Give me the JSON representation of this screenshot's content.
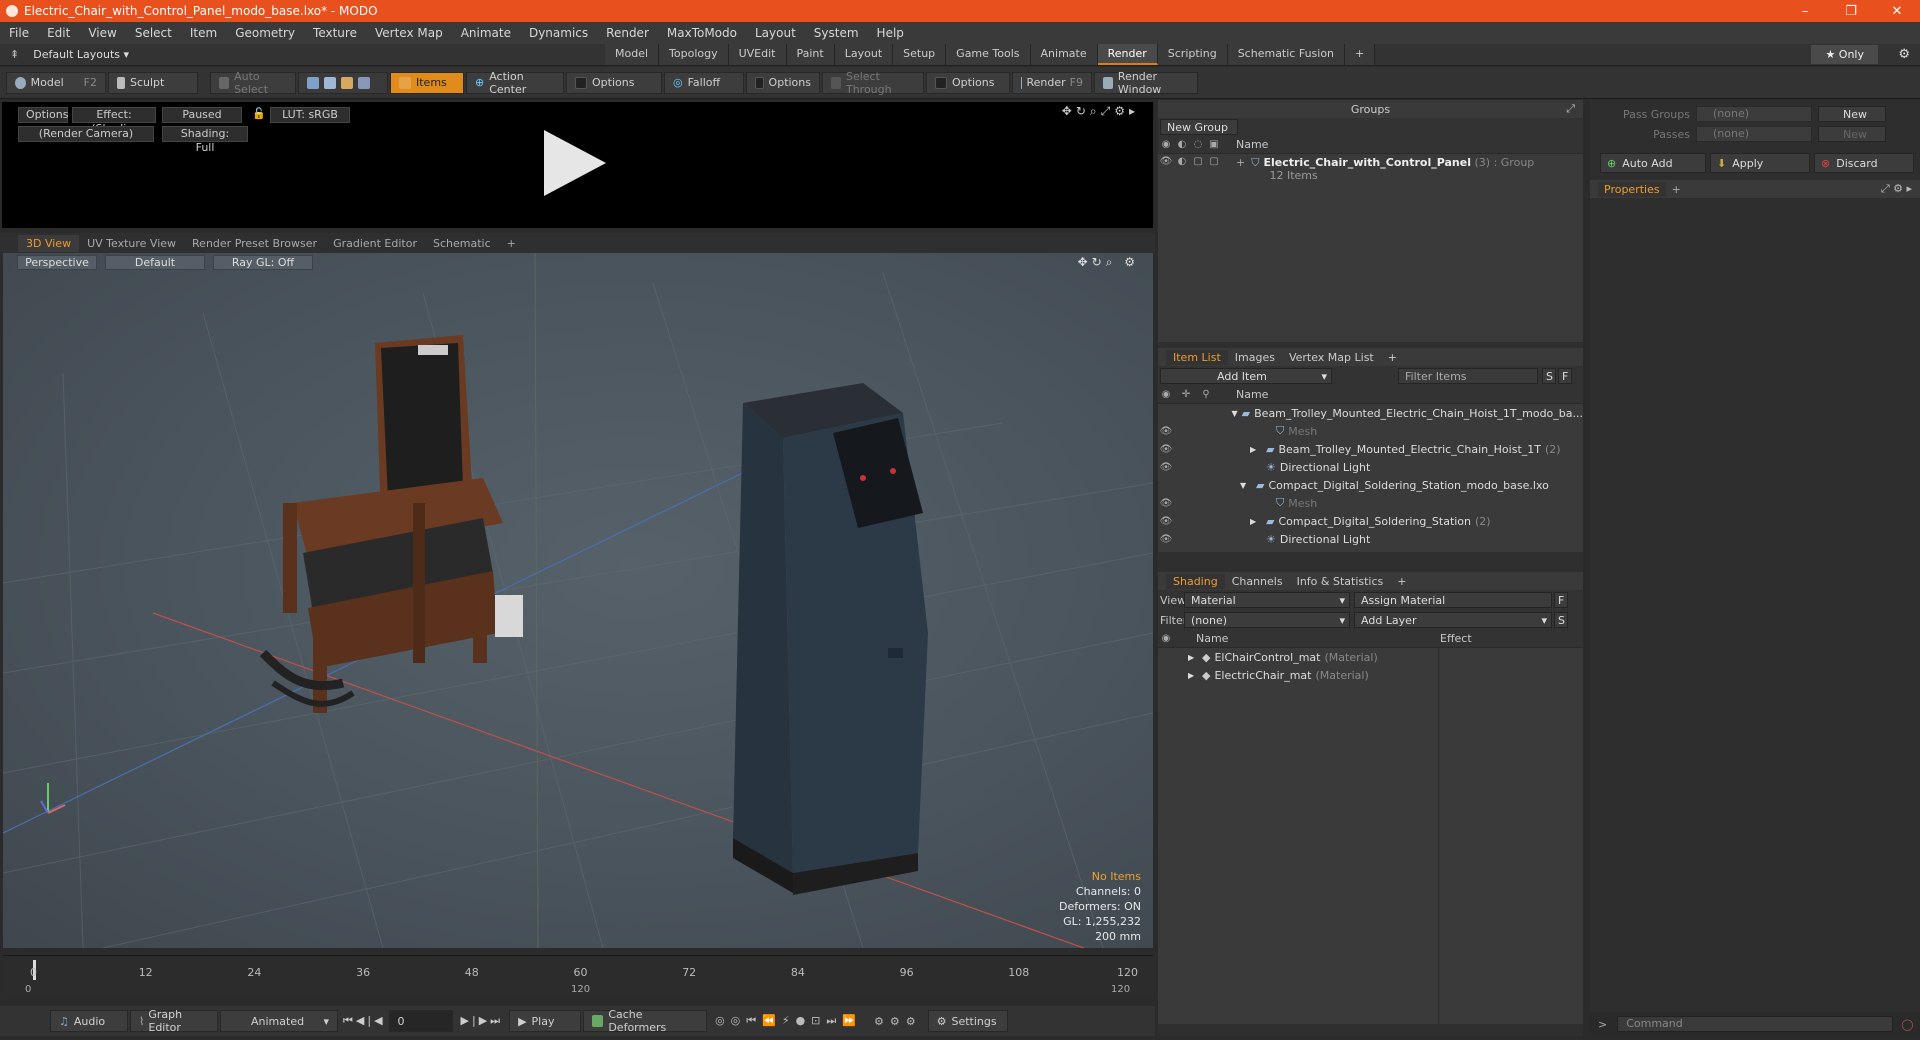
{
  "window": {
    "title": "Electric_Chair_with_Control_Panel_modo_base.lxo* - MODO",
    "controls": [
      "–",
      "❐",
      "✕"
    ]
  },
  "menu": [
    "File",
    "Edit",
    "View",
    "Select",
    "Item",
    "Geometry",
    "Texture",
    "Vertex Map",
    "Animate",
    "Dynamics",
    "Render",
    "MaxToModo",
    "Layout",
    "System",
    "Help"
  ],
  "layoutbar": {
    "layout_label": "Default Layouts ▾",
    "tabs": [
      "Model",
      "Topology",
      "UVEdit",
      "Paint",
      "Layout",
      "Setup",
      "Game Tools",
      "Animate",
      "Render",
      "Scripting",
      "Schematic Fusion",
      "+"
    ],
    "active_tab": "Render",
    "only_label": "★  Only"
  },
  "toolbar": {
    "model": "Model",
    "model_key": "F2",
    "sculpt": "Sculpt",
    "auto_select": "Auto Select",
    "items": "Items",
    "action_center": "Action Center",
    "options1": "Options",
    "falloff": "Falloff",
    "options2": "Options",
    "select_through": "Select Through",
    "options3": "Options",
    "render": "Render",
    "render_key": "F9",
    "render_window": "Render Window"
  },
  "preview": {
    "options": "Options",
    "effect": "Effect: (Shadi...",
    "paused": "Paused",
    "lut": "LUT: sRGB",
    "camera": "(Render Camera)",
    "shading": "Shading: Full"
  },
  "viewtabs": [
    "3D View",
    "UV Texture View",
    "Render Preset Browser",
    "Gradient Editor",
    "Schematic",
    "+"
  ],
  "viewport": {
    "perspective": "Perspective",
    "default": "Default",
    "raygl": "Ray GL: Off",
    "info": {
      "no_items": "No Items",
      "channels": "Channels: 0",
      "deformers": "Deformers: ON",
      "gl": "GL: 1,255,232",
      "scale": "200 mm"
    }
  },
  "timeline": {
    "ticks": [
      "0",
      "12",
      "24",
      "36",
      "48",
      "60",
      "72",
      "84",
      "96",
      "108",
      "120"
    ],
    "lower_left": "0",
    "lower_mid": "120",
    "lower_right": "120"
  },
  "bottombar": {
    "audio": "Audio",
    "graph_editor": "Graph Editor",
    "animated": "Animated",
    "frame": "0",
    "play": "Play",
    "cache_deformers": "Cache Deformers",
    "settings": "Settings"
  },
  "groups": {
    "title": "Groups",
    "new_group": "New Group",
    "col_name": "Name",
    "row_name": "Electric_Chair_with_Control_Panel",
    "row_count": "(3)",
    "row_type": ": Group",
    "row_items": "12 Items"
  },
  "itemlist": {
    "tabs": [
      "Item List",
      "Images",
      "Vertex Map List",
      "+"
    ],
    "add_item": "Add Item",
    "filter": "Filter Items",
    "col_name": "Name",
    "rows": [
      {
        "label": "Beam_Trolley_Mounted_Electric_Chain_Hoist_1T_modo_ba...",
        "suffix": "",
        "indent": 0,
        "arrow": "▼",
        "dim": false
      },
      {
        "label": "Mesh",
        "suffix": "",
        "indent": 2,
        "arrow": "",
        "dim": true
      },
      {
        "label": "Beam_Trolley_Mounted_Electric_Chain_Hoist_1T",
        "suffix": "(2)",
        "indent": 1,
        "arrow": "▶",
        "dim": false
      },
      {
        "label": "Directional Light",
        "suffix": "",
        "indent": 1,
        "arrow": "",
        "dim": false
      },
      {
        "label": "Compact_Digital_Soldering_Station_modo_base.lxo",
        "suffix": "",
        "indent": 0,
        "arrow": "▼",
        "dim": false
      },
      {
        "label": "Mesh",
        "suffix": "",
        "indent": 2,
        "arrow": "",
        "dim": true
      },
      {
        "label": "Compact_Digital_Soldering_Station",
        "suffix": "(2)",
        "indent": 1,
        "arrow": "▶",
        "dim": false
      },
      {
        "label": "Directional Light",
        "suffix": "",
        "indent": 1,
        "arrow": "",
        "dim": false
      }
    ]
  },
  "shading": {
    "tabs": [
      "Shading",
      "Channels",
      "Info & Statistics",
      "+"
    ],
    "view_label": "View",
    "view_value": "Material",
    "assign": "Assign Material",
    "filter_label": "Filter",
    "filter_value": "(none)",
    "add_layer": "Add Layer",
    "col_name": "Name",
    "col_effect": "Effect",
    "rows": [
      {
        "name": "ElChairControl_mat",
        "type": "(Material)"
      },
      {
        "name": "ElectricChair_mat",
        "type": "(Material)"
      }
    ]
  },
  "passes": {
    "pass_groups": "Pass Groups",
    "pass_groups_val": "(none)",
    "new": "New",
    "passes": "Passes",
    "passes_val": "(none)",
    "new2": "New",
    "auto_add": "Auto Add",
    "apply": "Apply",
    "discard": "Discard",
    "properties": "Properties",
    "command": "Command"
  }
}
